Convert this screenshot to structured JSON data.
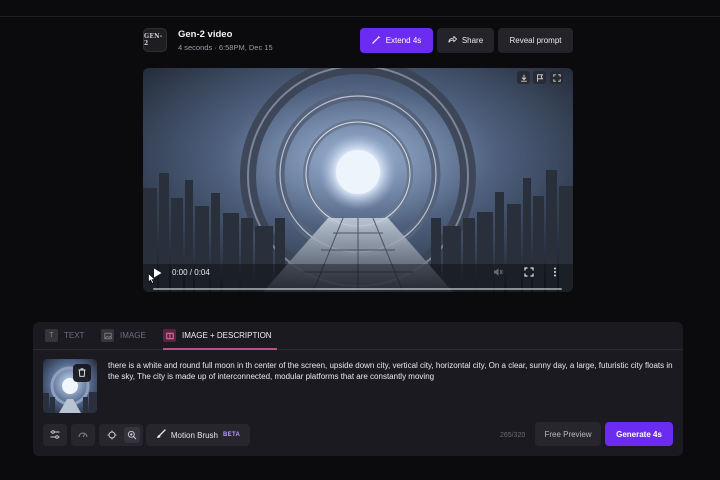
{
  "header": {
    "logo_text": "GEN-2",
    "title": "Gen-2 video",
    "subtitle": "4 seconds · 6:58PM, Dec 15",
    "extend_label": "Extend 4s",
    "share_label": "Share",
    "reveal_label": "Reveal prompt"
  },
  "video": {
    "time": "0:00 / 0:04",
    "progress": 0,
    "top_icons": [
      "download-icon",
      "flag-icon",
      "expand-icon"
    ],
    "control_icons": [
      "play-icon",
      "mute-icon",
      "fullscreen-icon",
      "more-icon"
    ]
  },
  "tabs": [
    {
      "label": "TEXT",
      "icon": "text-icon",
      "active": false
    },
    {
      "label": "IMAGE",
      "icon": "image-icon",
      "active": false
    },
    {
      "label": "IMAGE + DESCRIPTION",
      "icon": "image-description-icon",
      "active": true
    }
  ],
  "prompt": {
    "text": "there is a white and round full moon in th center of the screen, upside down city, vertical city, horizontal city, On a clear, sunny day, a large, futuristic city floats in the sky, The city is made up of interconnected, modular platforms that are constantly moving"
  },
  "toolbar": {
    "motion_brush_label": "Motion Brush",
    "beta_label": "BETA",
    "char_count": "265/320",
    "preview_label": "Free Preview",
    "generate_label": "Generate 4s"
  },
  "colors": {
    "accent": "#6c2bf0",
    "tab_accent": "#c24b8c",
    "background": "#0b0b0e",
    "panel": "#1a1a20"
  }
}
